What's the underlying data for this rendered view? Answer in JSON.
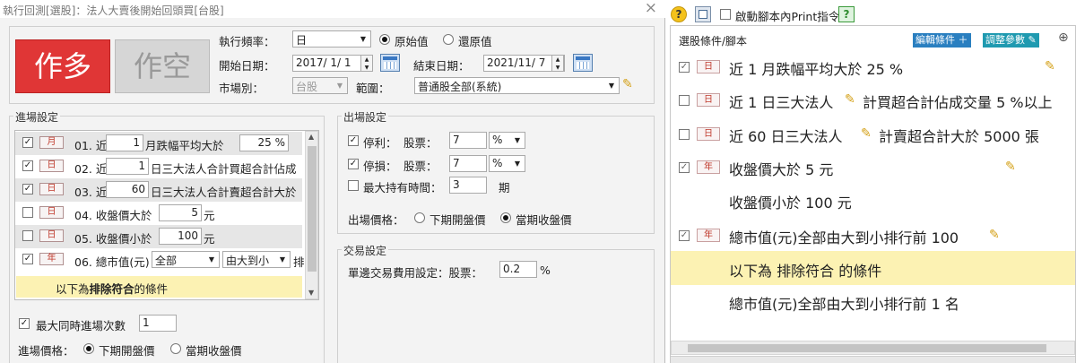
{
  "window": {
    "title": "執行回測[選股]：法人大賣後開始回頭買[台股]",
    "close": "×"
  },
  "buy_button": "作多",
  "sell_button": "作空",
  "params": {
    "freq_label": "執行頻率：",
    "freq_value": "日",
    "raw_label": "原始值",
    "restore_label": "還原值",
    "start_label": "開始日期：",
    "start_value": "2017/ 1/ 1",
    "end_label": "結束日期：",
    "end_value": "2021/11/ 7",
    "market_label": "市場別：",
    "market_value": "台股",
    "range_label": "範圍：",
    "range_value": "普通股全部(系統)"
  },
  "entry": {
    "legend": "進場設定",
    "rows": [
      {
        "checked": "✓",
        "tag": "月",
        "text": "01. 近",
        "value": "1",
        "text2": "月跌幅平均大於",
        "value2": "25 %"
      },
      {
        "checked": "✓",
        "tag": "日",
        "text": "02. 近",
        "value": "1",
        "text2": "日三大法人合計買超合計佔成"
      },
      {
        "checked": "✓",
        "tag": "日",
        "text": "03. 近",
        "value": "60",
        "text2": "日三大法人合計賣超合計大於"
      },
      {
        "checked": "",
        "tag": "日",
        "text": "04. 收盤價大於",
        "value": "5",
        "text2": "元"
      },
      {
        "checked": "",
        "tag": "日",
        "text": "05. 收盤價小於",
        "value": "100",
        "text2": "元"
      },
      {
        "checked": "✓",
        "tag": "年",
        "text": "06. 總市值(元)",
        "value": "全部",
        "text2": "由大到小",
        "text3": "排"
      }
    ],
    "exclude_prefix": "以下為",
    "exclude_bold": "排除符合",
    "exclude_suffix": "的條件",
    "max_entries_label": "最大同時進場次數",
    "max_entries_value": "1",
    "entry_price_label": "進場價格：",
    "next_open": "下期開盤價",
    "current_close": "當期收盤價"
  },
  "exit": {
    "legend": "出場設定",
    "stop_profit_label": "停利：",
    "stock_label": "股票：",
    "stop_profit_value": "7",
    "unit": "%",
    "stop_loss_label": "停損：",
    "stop_loss_value": "7",
    "max_hold_label": "最大持有時間：",
    "max_hold_value": "3",
    "period": "期",
    "exit_price_label": "出場價格：",
    "next_open": "下期開盤價",
    "current_close": "當期收盤價"
  },
  "trade": {
    "legend": "交易設定",
    "fee_label": "單邊交易費用設定：股票：",
    "fee_value": "0.2",
    "unit": "%"
  },
  "right": {
    "print_label": "啟動腳本內Print指令",
    "header": "選股條件/腳本",
    "edit_button": "編輯條件",
    "adjust_button": "調整參數",
    "conditions": [
      {
        "tag": "日",
        "text": "近 1 月跌幅平均大於 25 %"
      },
      {
        "tag": "日",
        "text": "近 1 日三大法人",
        "text2": "計買超合計佔成交量 5 %以上"
      },
      {
        "tag": "日",
        "text": "近 60 日三大法人",
        "text2": "計賣超合計大於 5000 張"
      },
      {
        "tag": "年",
        "text": "收盤價大於 5 元"
      },
      {
        "text": "收盤價小於 100 元"
      },
      {
        "tag": "年",
        "text": "總市值(元)全部由大到小排行前 100"
      },
      {
        "text_prefix": "以下為",
        "text_bold": "排除符合",
        "text_suffix": "的條件"
      },
      {
        "text": "總市值(元)全部由大到小排行前 1 名"
      }
    ]
  }
}
